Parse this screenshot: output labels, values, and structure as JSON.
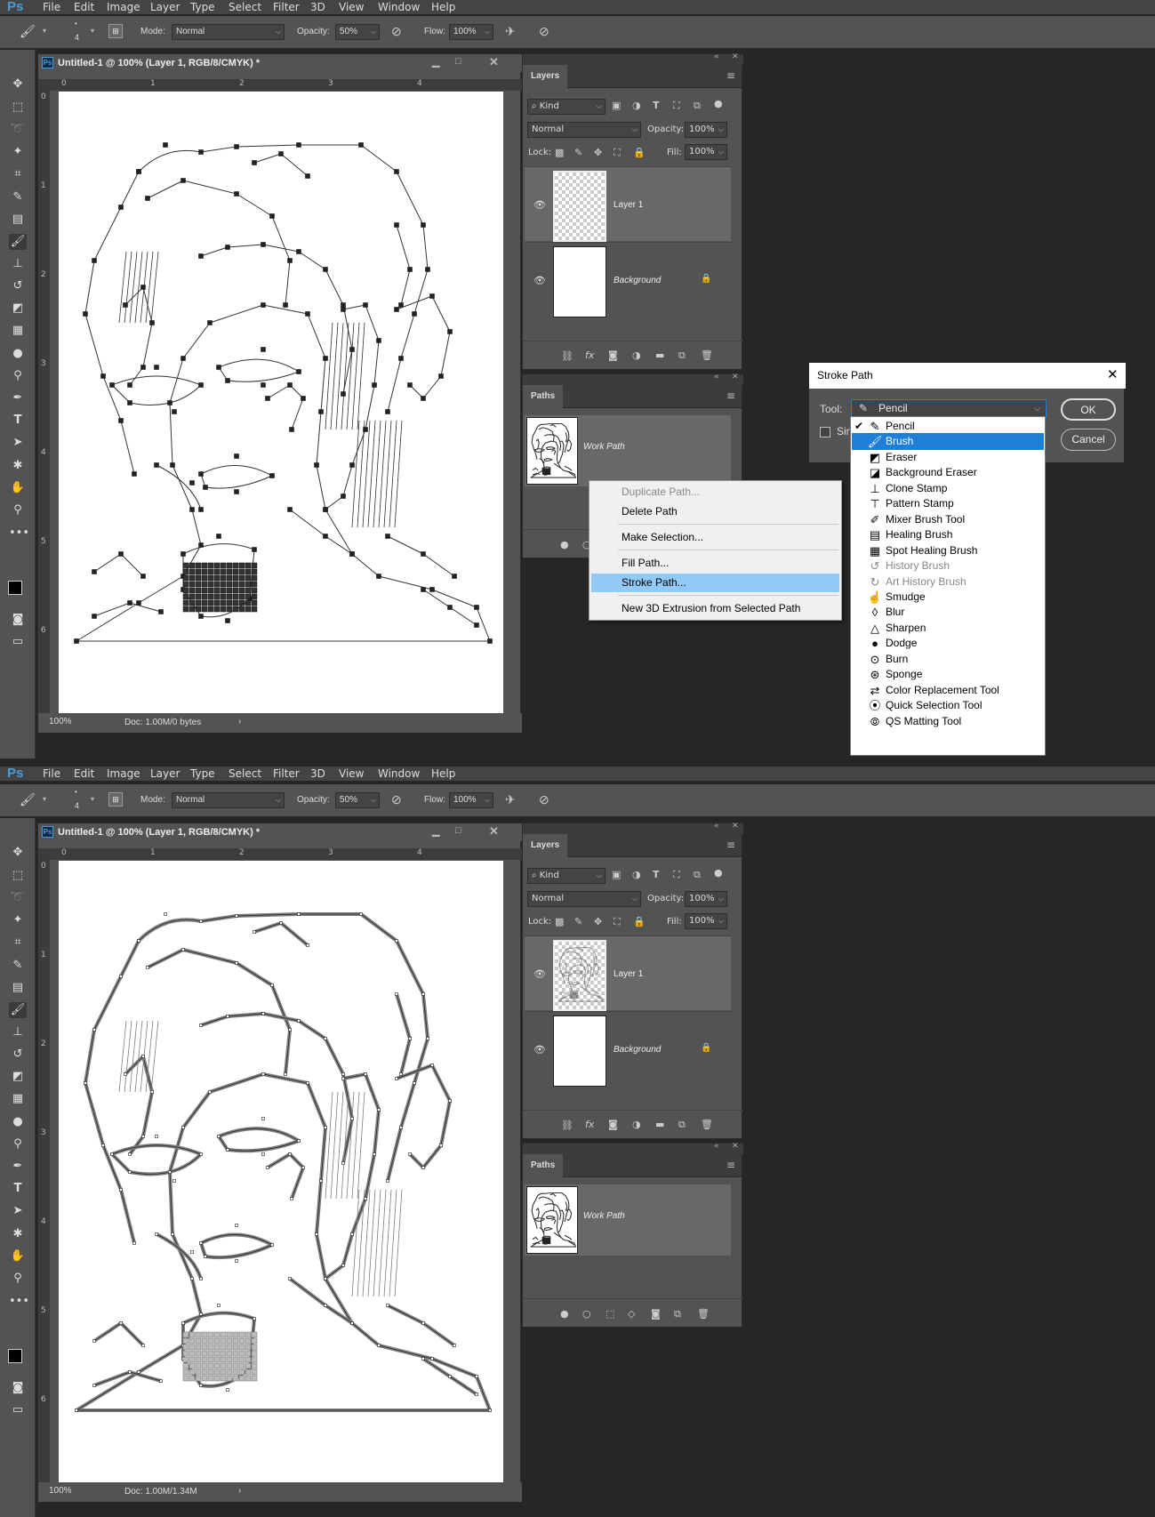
{
  "app": {
    "logo": "Ps"
  },
  "menu": [
    "File",
    "Edit",
    "Image",
    "Layer",
    "Type",
    "Select",
    "Filter",
    "3D",
    "View",
    "Window",
    "Help"
  ],
  "options": {
    "brush_size": "4",
    "mode_label": "Mode:",
    "mode_value": "Normal",
    "opacity_label": "Opacity:",
    "opacity_value": "50%",
    "flow_label": "Flow:",
    "flow_value": "100%"
  },
  "document": {
    "title": "Untitled-1 @ 100% (Layer 1, RGB/8/CMYK) *",
    "zoom": "100%",
    "doc_size_before": "Doc: 1.00M/0 bytes",
    "doc_size_after": "Doc: 1.00M/1.34M"
  },
  "rulers": {
    "h": [
      "0",
      "1",
      "2",
      "3",
      "4"
    ],
    "v": [
      "0",
      "1",
      "2",
      "3",
      "4",
      "5",
      "6"
    ]
  },
  "layers": {
    "tab": "Layers",
    "filter": "⌕ Kind",
    "blend_mode": "Normal",
    "opacity_label": "Opacity:",
    "opacity_value": "100%",
    "lock_label": "Lock:",
    "fill_label": "Fill:",
    "fill_value": "100%",
    "items": [
      {
        "name": "Layer 1",
        "visible": true,
        "selected": true
      },
      {
        "name": "Background",
        "visible": true,
        "locked": true
      }
    ]
  },
  "paths": {
    "tab": "Paths",
    "items": [
      {
        "name": "Work Path"
      }
    ]
  },
  "context_menu": {
    "items": [
      "Duplicate Path...",
      "Delete Path",
      "Make Selection...",
      "Fill Path...",
      "Stroke Path...",
      "New 3D Extrusion from Selected Path"
    ],
    "disabled": [
      "Duplicate Path..."
    ],
    "highlighted": "Stroke Path..."
  },
  "dialog": {
    "title": "Stroke Path",
    "tool_label": "Tool:",
    "tool_value": "Pencil",
    "checkbox_label": "Sin",
    "ok": "OK",
    "cancel": "Cancel"
  },
  "tool_dropdown": {
    "checked": "Pencil",
    "highlighted": "Brush",
    "items": [
      {
        "label": "Pencil",
        "icon": "pencil-icon"
      },
      {
        "label": "Brush",
        "icon": "brush-icon"
      },
      {
        "label": "Eraser",
        "icon": "eraser-icon"
      },
      {
        "label": "Background Eraser",
        "icon": "background-eraser-icon"
      },
      {
        "label": "Clone Stamp",
        "icon": "clone-stamp-icon"
      },
      {
        "label": "Pattern Stamp",
        "icon": "pattern-stamp-icon"
      },
      {
        "label": "Mixer Brush Tool",
        "icon": "mixer-brush-icon"
      },
      {
        "label": "Healing Brush",
        "icon": "healing-brush-icon"
      },
      {
        "label": "Spot Healing Brush",
        "icon": "spot-healing-icon"
      },
      {
        "label": "History Brush",
        "icon": "history-brush-icon",
        "disabled": true
      },
      {
        "label": "Art History Brush",
        "icon": "art-history-brush-icon",
        "disabled": true
      },
      {
        "label": "Smudge",
        "icon": "smudge-icon"
      },
      {
        "label": "Blur",
        "icon": "blur-icon"
      },
      {
        "label": "Sharpen",
        "icon": "sharpen-icon"
      },
      {
        "label": "Dodge",
        "icon": "dodge-icon"
      },
      {
        "label": "Burn",
        "icon": "burn-icon"
      },
      {
        "label": "Sponge",
        "icon": "sponge-icon"
      },
      {
        "label": "Color Replacement Tool",
        "icon": "color-replacement-icon"
      },
      {
        "label": "Quick Selection Tool",
        "icon": "quick-selection-icon"
      },
      {
        "label": "QS Matting Tool",
        "icon": "qs-matting-icon"
      }
    ]
  },
  "colors": {
    "selection": "#1e7fd8",
    "menu_highlight": "#91c9f7",
    "panel_bg": "#535353",
    "app_bg": "#262626"
  }
}
